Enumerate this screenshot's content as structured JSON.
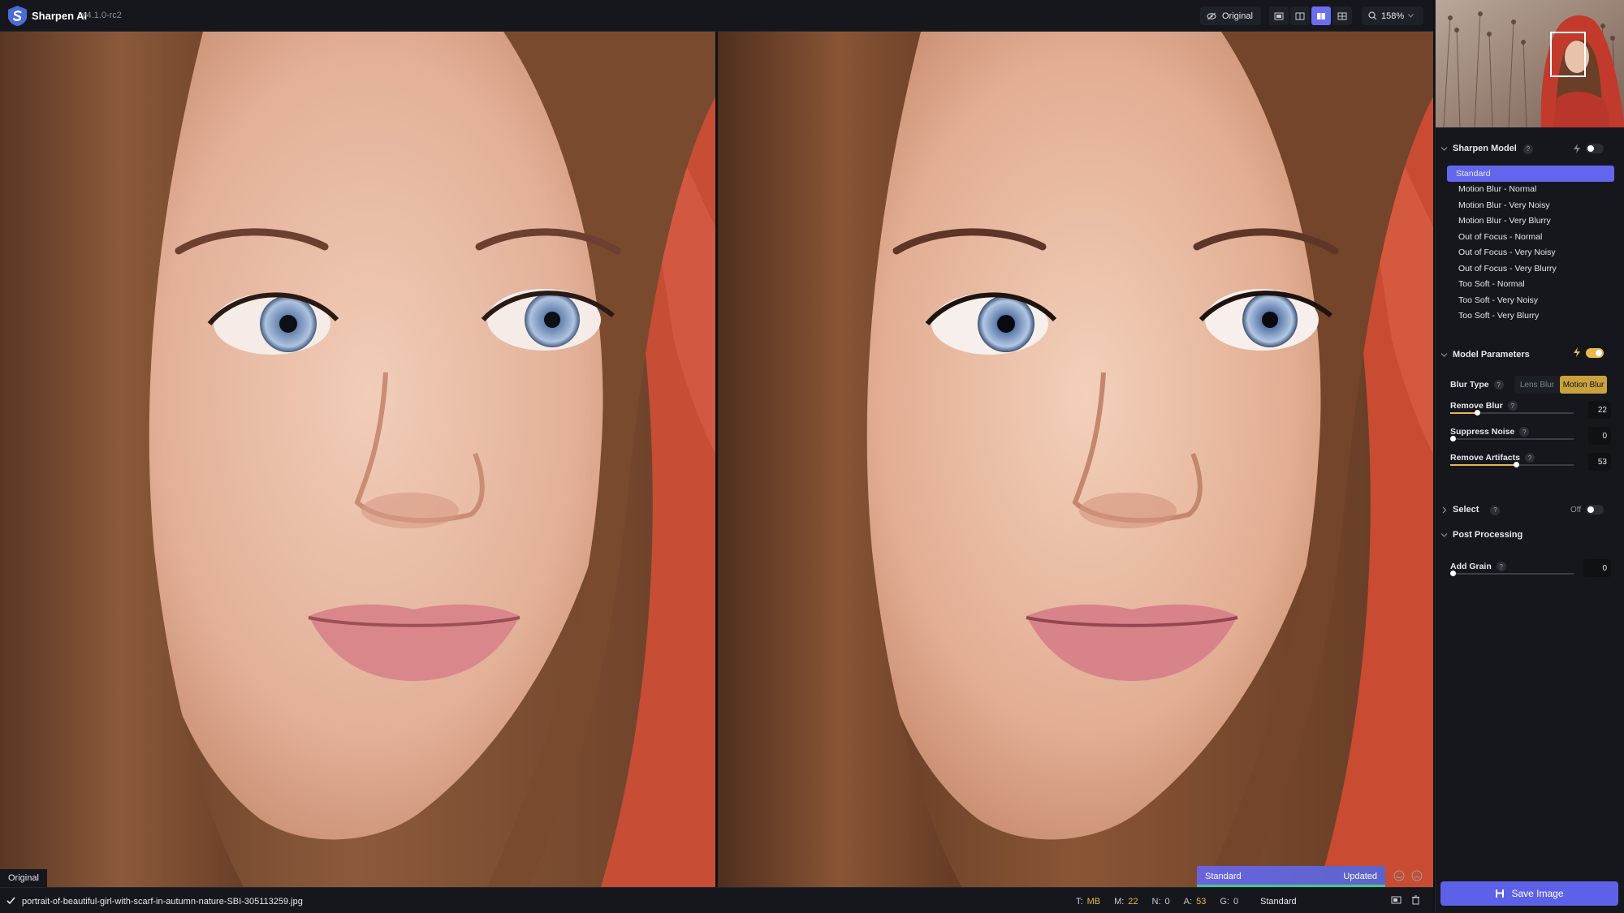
{
  "app": {
    "name": "Sharpen AI",
    "version": "v4.1.0-rc2"
  },
  "toolbar": {
    "original_label": "Original",
    "view_modes": [
      "single-view-icon",
      "split-view-icon",
      "side-by-side-view-icon",
      "quad-view-icon"
    ],
    "active_view_index": 2,
    "zoom_label": "158%"
  },
  "viewer": {
    "left_label": "Original",
    "status_model": "Standard",
    "status_state": "Updated"
  },
  "footer": {
    "filename": "portrait-of-beautiful-girl-with-scarf-in-autumn-nature-SBI-305113259.jpg",
    "stats": [
      {
        "key": "T:",
        "value": "MB"
      },
      {
        "key": "M:",
        "value": "22"
      },
      {
        "key": "N:",
        "value": "0"
      },
      {
        "key": "A:",
        "value": "53"
      },
      {
        "key": "G:",
        "value": "0"
      }
    ],
    "model": "Standard"
  },
  "panel": {
    "sharpen_model": {
      "title": "Sharpen Model",
      "help": "?",
      "items": [
        "Standard",
        "Motion Blur - Normal",
        "Motion Blur - Very Noisy",
        "Motion Blur - Very Blurry",
        "Out of Focus - Normal",
        "Out of Focus - Very Noisy",
        "Out of Focus - Very Blurry",
        "Too Soft - Normal",
        "Too Soft - Very Noisy",
        "Too Soft - Very Blurry"
      ],
      "selected_index": 0,
      "auto_enabled": false
    },
    "model_parameters": {
      "title": "Model Parameters",
      "auto_enabled": true,
      "blur_type_label": "Blur Type",
      "blur_options": [
        "Lens Blur",
        "Motion Blur"
      ],
      "blur_selected": "Motion Blur",
      "remove_blur": {
        "label": "Remove Blur",
        "value": "22",
        "level": 0.22
      },
      "suppress_noise": {
        "label": "Suppress Noise",
        "value": "0",
        "level": 0.0
      },
      "remove_artifacts": {
        "label": "Remove Artifacts",
        "value": "53",
        "level": 0.53
      }
    },
    "select": {
      "title": "Select",
      "state_label": "Off"
    },
    "post_processing": {
      "title": "Post Processing",
      "add_grain": {
        "label": "Add Grain",
        "value": "0",
        "level": 0.0
      }
    },
    "save_label": "Save Image"
  },
  "colors": {
    "accent": "#6466ee",
    "highlight": "#e7b84a",
    "background": "#15171c"
  }
}
